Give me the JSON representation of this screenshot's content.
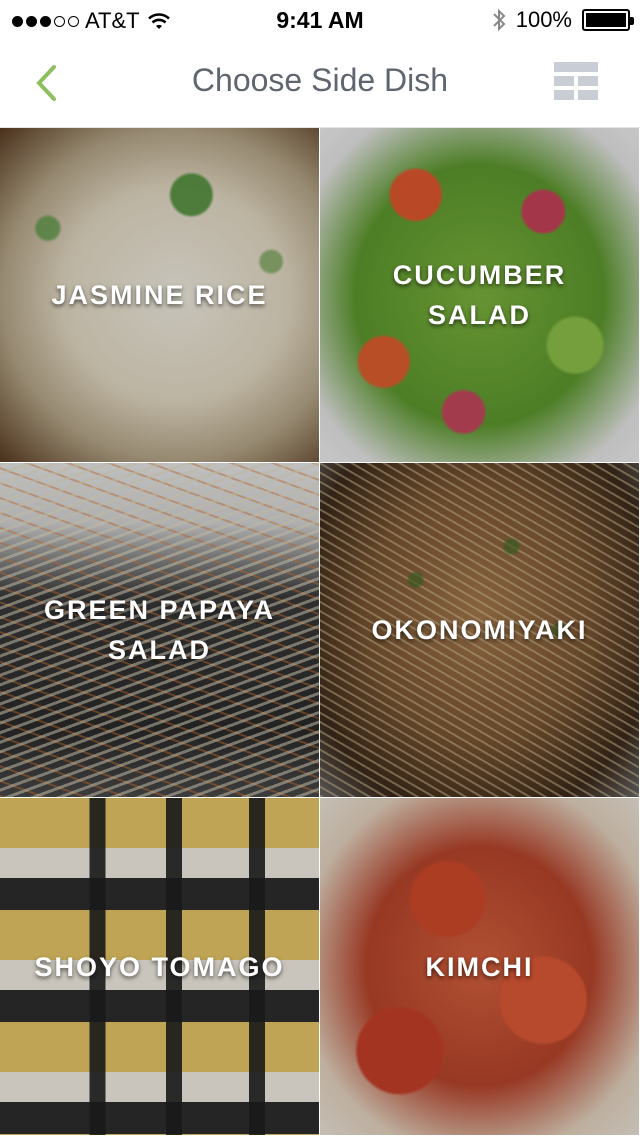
{
  "status_bar": {
    "carrier": "AT&T",
    "time": "9:41 AM",
    "battery": "100%",
    "battery_level": 1.0,
    "signal_filled": 3,
    "signal_total": 5,
    "icons": [
      "wifi-icon",
      "bluetooth-icon",
      "battery-icon"
    ]
  },
  "nav": {
    "title": "Choose Side Dish",
    "back_icon": "chevron-left-icon",
    "view_toggle_icon": "grid-view-icon",
    "accent_color": "#8dbf5e"
  },
  "dishes": [
    {
      "label": "JASMINE RICE",
      "slug": "jasmine-rice"
    },
    {
      "label": "CUCUMBER\nSALAD",
      "slug": "cucumber-salad"
    },
    {
      "label": "GREEN PAPAYA\nSALAD",
      "slug": "green-papaya-salad"
    },
    {
      "label": "OKONOMIYAKI",
      "slug": "okonomiyaki"
    },
    {
      "label": "SHOYO TOMAGO",
      "slug": "shoyo-tomago"
    },
    {
      "label": "KIMCHI",
      "slug": "kimchi"
    }
  ]
}
